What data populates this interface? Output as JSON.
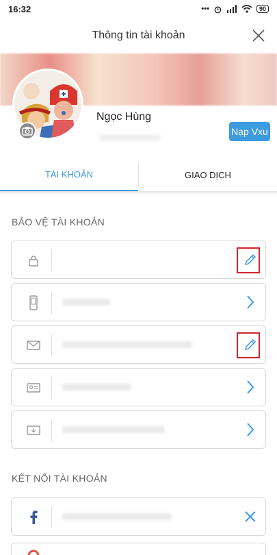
{
  "status_bar": {
    "time": "16:32",
    "dots": "•••",
    "battery": "90"
  },
  "header": {
    "title": "Thông tin tài khoản"
  },
  "profile": {
    "name": "Ngọc Hùng",
    "topup_label": "Nạp Vxu"
  },
  "tabs": [
    {
      "label": "TÀI KHOẢN",
      "active": true
    },
    {
      "label": "GIAO DỊCH",
      "active": false
    }
  ],
  "sections": {
    "protect_title": "BẢO VỆ TÀI KHOẢN",
    "connect_title": "KẾT NỐI TÀI KHOẢN"
  },
  "colors": {
    "accent": "#3d9be0",
    "highlight": "#d0272b",
    "facebook": "#3b5998"
  },
  "icons": {
    "row1": "lock-icon",
    "row2": "phone-icon",
    "row3": "mail-icon",
    "row4": "id-card-icon",
    "row5": "monitor-icon",
    "fb": "facebook-icon"
  }
}
